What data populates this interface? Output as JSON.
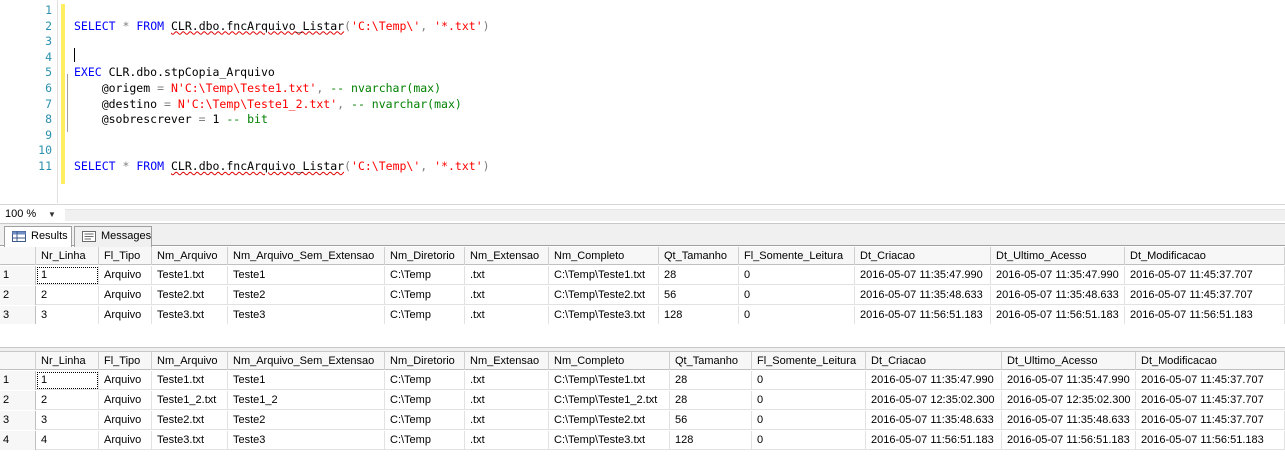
{
  "editor": {
    "lines": [
      {
        "n": "1",
        "parts": []
      },
      {
        "n": "2",
        "parts": [
          [
            "kw",
            "SELECT"
          ],
          [
            "plain",
            " "
          ],
          [
            "gray",
            "*"
          ],
          [
            "plain",
            " "
          ],
          [
            "kw",
            "FROM"
          ],
          [
            "plain",
            " "
          ],
          [
            "squig",
            "CLR.dbo.fncArquivo_Listar"
          ],
          [
            "gray",
            "("
          ],
          [
            "str",
            "'C:\\Temp\\'"
          ],
          [
            "gray",
            ","
          ],
          [
            "plain",
            " "
          ],
          [
            "str",
            "'*.txt'"
          ],
          [
            "gray",
            ")"
          ]
        ]
      },
      {
        "n": "3",
        "parts": []
      },
      {
        "n": "4",
        "parts": []
      },
      {
        "n": "5",
        "parts": [
          [
            "kw",
            "EXEC"
          ],
          [
            "plain",
            " CLR.dbo.stpCopia_Arquivo"
          ]
        ]
      },
      {
        "n": "6",
        "parts": [
          [
            "plain",
            "    @origem "
          ],
          [
            "gray",
            "="
          ],
          [
            "plain",
            " "
          ],
          [
            "str",
            "N'C:\\Temp\\Teste1.txt'"
          ],
          [
            "gray",
            ","
          ],
          [
            "plain",
            " "
          ],
          [
            "cmt",
            "-- nvarchar(max)"
          ]
        ]
      },
      {
        "n": "7",
        "parts": [
          [
            "plain",
            "    @destino "
          ],
          [
            "gray",
            "="
          ],
          [
            "plain",
            " "
          ],
          [
            "str",
            "N'C:\\Temp\\Teste1_2.txt'"
          ],
          [
            "gray",
            ","
          ],
          [
            "plain",
            " "
          ],
          [
            "cmt",
            "-- nvarchar(max)"
          ]
        ]
      },
      {
        "n": "8",
        "parts": [
          [
            "plain",
            "    @sobrescrever "
          ],
          [
            "gray",
            "="
          ],
          [
            "plain",
            " 1 "
          ],
          [
            "cmt",
            "-- bit"
          ]
        ]
      },
      {
        "n": "9",
        "parts": []
      },
      {
        "n": "10",
        "parts": []
      },
      {
        "n": "11",
        "parts": [
          [
            "kw",
            "SELECT"
          ],
          [
            "plain",
            " "
          ],
          [
            "gray",
            "*"
          ],
          [
            "plain",
            " "
          ],
          [
            "kw",
            "FROM"
          ],
          [
            "plain",
            " "
          ],
          [
            "squig",
            "CLR.dbo.fncArquivo_Listar"
          ],
          [
            "gray",
            "("
          ],
          [
            "str",
            "'C:\\Temp\\'"
          ],
          [
            "gray",
            ","
          ],
          [
            "plain",
            " "
          ],
          [
            "str",
            "'*.txt'"
          ],
          [
            "gray",
            ")"
          ]
        ]
      }
    ]
  },
  "zoom": {
    "value": "100 %"
  },
  "tabs": {
    "results": "Results",
    "messages": "Messages"
  },
  "grid1": {
    "columns": [
      "Nr_Linha",
      "Fl_Tipo",
      "Nm_Arquivo",
      "Nm_Arquivo_Sem_Extensao",
      "Nm_Diretorio",
      "Nm_Extensao",
      "Nm_Completo",
      "Qt_Tamanho",
      "Fl_Somente_Leitura",
      "Dt_Criacao",
      "Dt_Ultimo_Acesso",
      "Dt_Modificacao"
    ],
    "rows": [
      [
        "1",
        "1",
        "Arquivo",
        "Teste1.txt",
        "Teste1",
        "C:\\Temp",
        ".txt",
        "C:\\Temp\\Teste1.txt",
        "28",
        "0",
        "2016-05-07 11:35:47.990",
        "2016-05-07 11:35:47.990",
        "2016-05-07 11:45:37.707"
      ],
      [
        "2",
        "2",
        "Arquivo",
        "Teste2.txt",
        "Teste2",
        "C:\\Temp",
        ".txt",
        "C:\\Temp\\Teste2.txt",
        "56",
        "0",
        "2016-05-07 11:35:48.633",
        "2016-05-07 11:35:48.633",
        "2016-05-07 11:45:37.707"
      ],
      [
        "3",
        "3",
        "Arquivo",
        "Teste3.txt",
        "Teste3",
        "C:\\Temp",
        ".txt",
        "C:\\Temp\\Teste3.txt",
        "128",
        "0",
        "2016-05-07 11:56:51.183",
        "2016-05-07 11:56:51.183",
        "2016-05-07 11:56:51.183"
      ]
    ]
  },
  "grid2": {
    "columns": [
      "Nr_Linha",
      "Fl_Tipo",
      "Nm_Arquivo",
      "Nm_Arquivo_Sem_Extensao",
      "Nm_Diretorio",
      "Nm_Extensao",
      "Nm_Completo",
      "Qt_Tamanho",
      "Fl_Somente_Leitura",
      "Dt_Criacao",
      "Dt_Ultimo_Acesso",
      "Dt_Modificacao"
    ],
    "rows": [
      [
        "1",
        "1",
        "Arquivo",
        "Teste1.txt",
        "Teste1",
        "C:\\Temp",
        ".txt",
        "C:\\Temp\\Teste1.txt",
        "28",
        "0",
        "2016-05-07 11:35:47.990",
        "2016-05-07 11:35:47.990",
        "2016-05-07 11:45:37.707"
      ],
      [
        "2",
        "2",
        "Arquivo",
        "Teste1_2.txt",
        "Teste1_2",
        "C:\\Temp",
        ".txt",
        "C:\\Temp\\Teste1_2.txt",
        "28",
        "0",
        "2016-05-07 12:35:02.300",
        "2016-05-07 12:35:02.300",
        "2016-05-07 11:45:37.707"
      ],
      [
        "3",
        "3",
        "Arquivo",
        "Teste2.txt",
        "Teste2",
        "C:\\Temp",
        ".txt",
        "C:\\Temp\\Teste2.txt",
        "56",
        "0",
        "2016-05-07 11:35:48.633",
        "2016-05-07 11:35:48.633",
        "2016-05-07 11:45:37.707"
      ],
      [
        "4",
        "4",
        "Arquivo",
        "Teste3.txt",
        "Teste3",
        "C:\\Temp",
        ".txt",
        "C:\\Temp\\Teste3.txt",
        "128",
        "0",
        "2016-05-07 11:56:51.183",
        "2016-05-07 11:56:51.183",
        "2016-05-07 11:56:51.183"
      ]
    ]
  }
}
